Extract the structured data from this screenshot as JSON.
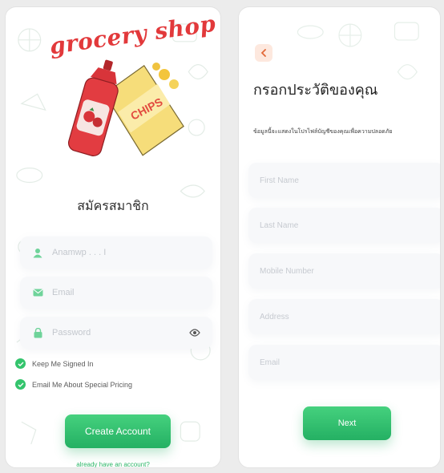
{
  "signup": {
    "brand": "grocery shop",
    "hero_label": "CHIPS",
    "heading": "สมัครสมาชิก",
    "fields": {
      "name_placeholder": "Anamwp . . . I",
      "email_placeholder": "Email",
      "password_placeholder": "Password"
    },
    "checks": {
      "keep_signed_in": "Keep Me Signed In",
      "email_pricing": "Email Me About Special Pricing"
    },
    "create_button": "Create Account",
    "login_link": "already have an account?"
  },
  "profile": {
    "back_icon": "chevron-left-icon",
    "title": "กรอกประวัติของคุณ",
    "subtitle": "ข้อมูลนี้จะแสดงในโปรไฟล์บัญชีของคุณเพื่อความปลอดภัย",
    "fields": {
      "first_name_placeholder": "First Name",
      "last_name_placeholder": "Last Name",
      "mobile_placeholder": "Mobile Number",
      "address_placeholder": "Address",
      "email_placeholder": "Email"
    },
    "next_button": "Next"
  },
  "colors": {
    "accent_green": "#2cb768",
    "brand_red": "#e2393b",
    "back_button_bg": "#fde8de"
  },
  "icons": {
    "name_field": "user-icon",
    "email_field": "mail-icon",
    "password_field": "lock-icon",
    "password_toggle": "eye-icon",
    "checkbox": "check-circle-icon"
  }
}
